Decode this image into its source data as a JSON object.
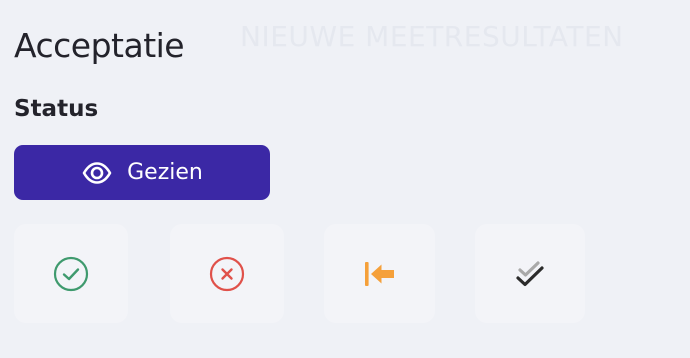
{
  "watermark_text": "NIEUWE MEETRESULTATEN",
  "panel": {
    "title": "Acceptatie",
    "status_label": "Status",
    "primary_button": {
      "label": "Gezien",
      "icon": "eye-icon"
    },
    "actions": [
      {
        "icon": "check-circle-icon",
        "color": "#3f9a6e"
      },
      {
        "icon": "x-circle-icon",
        "color": "#e0514a"
      },
      {
        "icon": "arrow-to-left-icon",
        "color": "#f5a03a"
      },
      {
        "icon": "double-check-icon",
        "color": "#2b2b2b",
        "secondary_color": "#a9a9a9"
      }
    ]
  },
  "colors": {
    "background": "#eff1f6",
    "primary": "#3b28a5",
    "tile": "#f3f4f8",
    "text": "#23232b"
  }
}
